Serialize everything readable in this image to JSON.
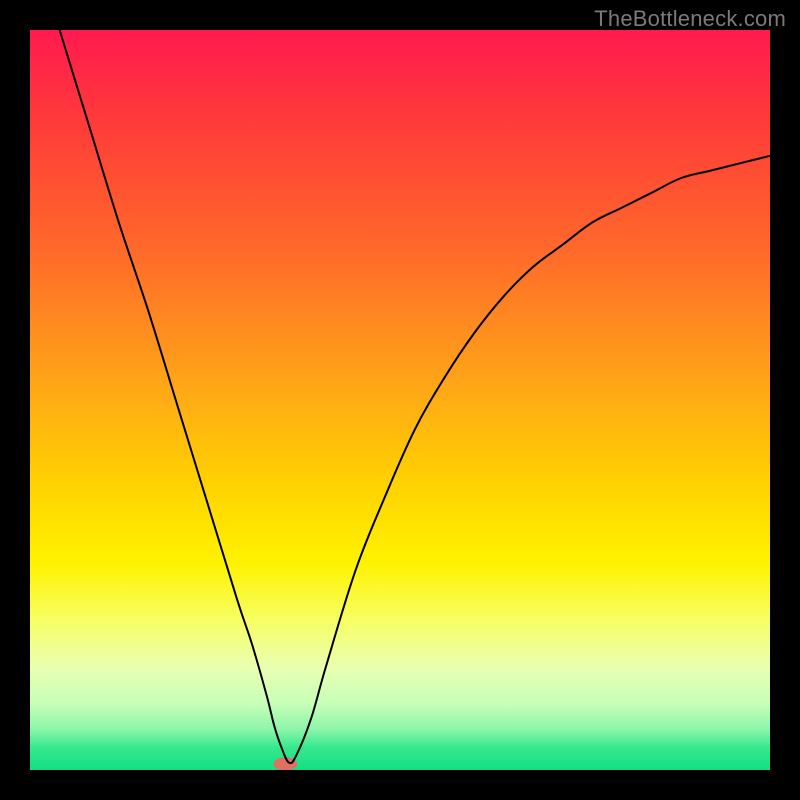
{
  "watermark": "TheBottleneck.com",
  "chart_data": {
    "type": "line",
    "title": "",
    "xlabel": "",
    "ylabel": "",
    "xlim": [
      0,
      100
    ],
    "ylim": [
      0,
      100
    ],
    "grid": false,
    "legend": false,
    "background_gradient": {
      "type": "vertical",
      "stops": [
        {
          "t": 0.0,
          "color": "#ff1a4f"
        },
        {
          "t": 0.12,
          "color": "#ff3a3a"
        },
        {
          "t": 0.3,
          "color": "#ff6a2a"
        },
        {
          "t": 0.48,
          "color": "#ffa617"
        },
        {
          "t": 0.62,
          "color": "#ffd400"
        },
        {
          "t": 0.72,
          "color": "#fff200"
        },
        {
          "t": 0.8,
          "color": "#f6ff66"
        },
        {
          "t": 0.86,
          "color": "#eaffb0"
        },
        {
          "t": 0.91,
          "color": "#c7ffb8"
        },
        {
          "t": 0.945,
          "color": "#8cf5a9"
        },
        {
          "t": 0.97,
          "color": "#36e88f"
        },
        {
          "t": 1.0,
          "color": "#13df84"
        }
      ]
    },
    "series": [
      {
        "name": "bottleneck-curve",
        "color": "#000000",
        "stroke_width": 2,
        "x": [
          4,
          8,
          12,
          16,
          20,
          24,
          28,
          30,
          32,
          33,
          34,
          35,
          36,
          38,
          40,
          44,
          48,
          52,
          56,
          60,
          64,
          68,
          72,
          76,
          80,
          84,
          88,
          92,
          96,
          100
        ],
        "y": [
          100,
          87,
          74,
          62,
          49,
          36,
          23,
          17,
          10,
          6,
          3,
          1,
          2,
          7,
          14,
          27,
          37,
          46,
          53,
          59,
          64,
          68,
          71,
          74,
          76,
          78,
          80,
          81,
          82,
          83
        ]
      }
    ],
    "annotations": [
      {
        "name": "minimum-marker",
        "shape": "ellipse",
        "cx": 34.5,
        "cy": 0.8,
        "rx": 1.6,
        "ry": 0.9,
        "fill": "#e07060"
      }
    ]
  }
}
